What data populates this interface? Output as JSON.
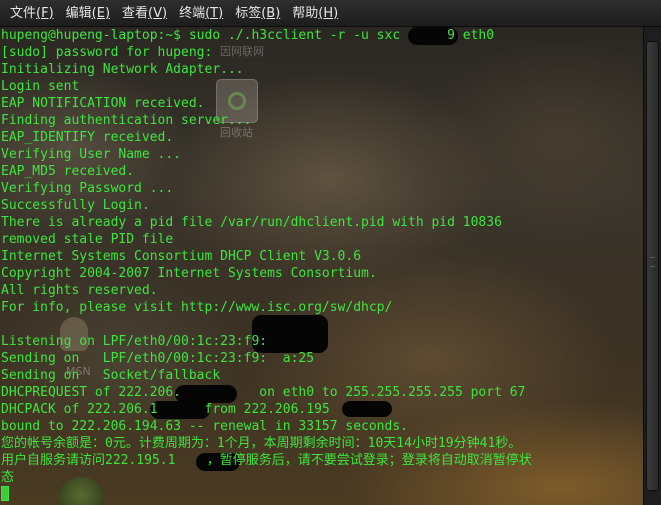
{
  "menubar": {
    "items": [
      {
        "label": "文件",
        "accel": "(F)"
      },
      {
        "label": "编辑",
        "accel": "(E)"
      },
      {
        "label": "查看",
        "accel": "(V)"
      },
      {
        "label": "终端",
        "accel": "(T)"
      },
      {
        "label": "标签",
        "accel": "(B)"
      },
      {
        "label": "帮助",
        "accel": "(H)"
      }
    ]
  },
  "desktop": {
    "icon_network_label": "因网联网",
    "icon_trash_label": "回收站",
    "icon_msn_label": "MSN"
  },
  "terminal": {
    "lines": [
      "hupeng@hupeng-laptop:~$ sudo ./.h3cclient -r -u sxc      9 eth0",
      "[sudo] password for hupeng:",
      "Initializing Network Adapter...",
      "Login sent",
      "EAP NOTIFICATION received.",
      "Finding authentication server...",
      "EAP_IDENTIFY received.",
      "Verifying User Name ...",
      "EAP_MD5 received.",
      "Verifying Password ...",
      "Successfully Login.",
      "There is already a pid file /var/run/dhclient.pid with pid 10836",
      "removed stale PID file",
      "Internet Systems Consortium DHCP Client V3.0.6",
      "Copyright 2004-2007 Internet Systems Consortium.",
      "All rights reserved.",
      "For info, please visit http://www.isc.org/sw/dhcp/",
      "",
      "Listening on LPF/eth0/00:1c:23:f9:",
      "Sending on   LPF/eth0/00:1c:23:f9:  a:25",
      "Sending on   Socket/fallback",
      "DHCPREQUEST of 222.206.          on eth0 to 255.255.255.255 port 67",
      "DHCPACK of 222.206.1      from 222.206.195",
      "bound to 222.206.194.63 -- renewal in 33157 seconds.",
      "您的帐号余额是：0元。计费周期为：1个月，本周期剩余时间：10天14小时19分钟41秒。",
      "用户自服务请访问222.195.1    ，暂停服务后，请不要尝试登录；登录将自动取消暂停状",
      "态",
      ""
    ]
  },
  "colors": {
    "terminal_text": "#3ee53e",
    "menubar_bg": "#262626",
    "menubar_text": "#e6e6e6"
  }
}
